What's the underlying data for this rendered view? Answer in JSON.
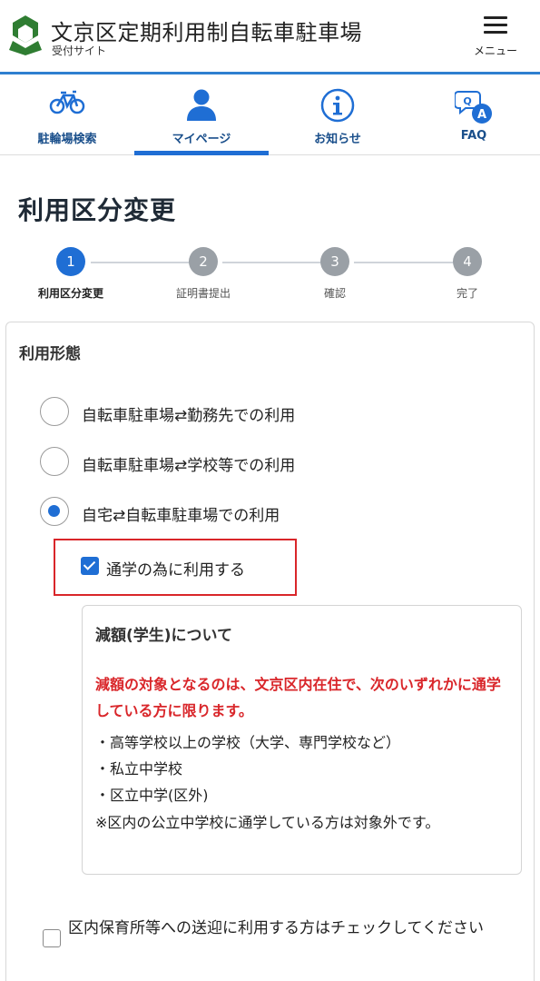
{
  "header": {
    "title": "文京区定期利用制自転車駐車場",
    "subtitle": "受付サイト",
    "menu_label": "メニュー",
    "accent_color": "#2e7fd0",
    "logo_icon": "bunkyo-ward-logo-icon"
  },
  "nav": {
    "tabs": [
      {
        "label": "駐輪場検索",
        "icon": "bicycle-icon",
        "active": false
      },
      {
        "label": "マイページ",
        "icon": "person-icon",
        "active": true
      },
      {
        "label": "お知らせ",
        "icon": "info-icon",
        "active": false
      },
      {
        "label": "FAQ",
        "icon": "qa-bubble-icon",
        "active": false
      }
    ]
  },
  "page": {
    "title": "利用区分変更"
  },
  "stepper": {
    "steps": [
      {
        "num": "1",
        "label": "利用区分変更",
        "active": true
      },
      {
        "num": "2",
        "label": "証明書提出",
        "active": false
      },
      {
        "num": "3",
        "label": "確認",
        "active": false
      },
      {
        "num": "4",
        "label": "完了",
        "active": false
      }
    ]
  },
  "form": {
    "section_label": "利用形態",
    "options": [
      {
        "label": "自転車駐車場⇄勤務先での利用",
        "checked": false
      },
      {
        "label": "自転車駐車場⇄学校等での利用",
        "checked": false
      },
      {
        "label": "自宅⇄自転車駐車場での利用",
        "checked": true
      }
    ],
    "school_check_label": "通学の為に利用する",
    "school_checked": true,
    "info": {
      "title": "減額(学生)について",
      "warning": "減額の対象となるのは、文京区内在住で、次のいずれかに通学している方に限ります。",
      "items": [
        "・高等学校以上の学校（大学、専門学校など）",
        "・私立中学校",
        "・区立中学(区外)"
      ],
      "note": "※区内の公立中学校に通学している方は対象外です。"
    },
    "nursery_check_label": "区内保育所等への送迎に利用する方はチェックしてください",
    "nursery_checked": false
  },
  "colors": {
    "primary": "#1f6ed4",
    "warning": "#d9262a",
    "nav_text": "#1a4f8b",
    "logo_green": "#2f7d32"
  }
}
